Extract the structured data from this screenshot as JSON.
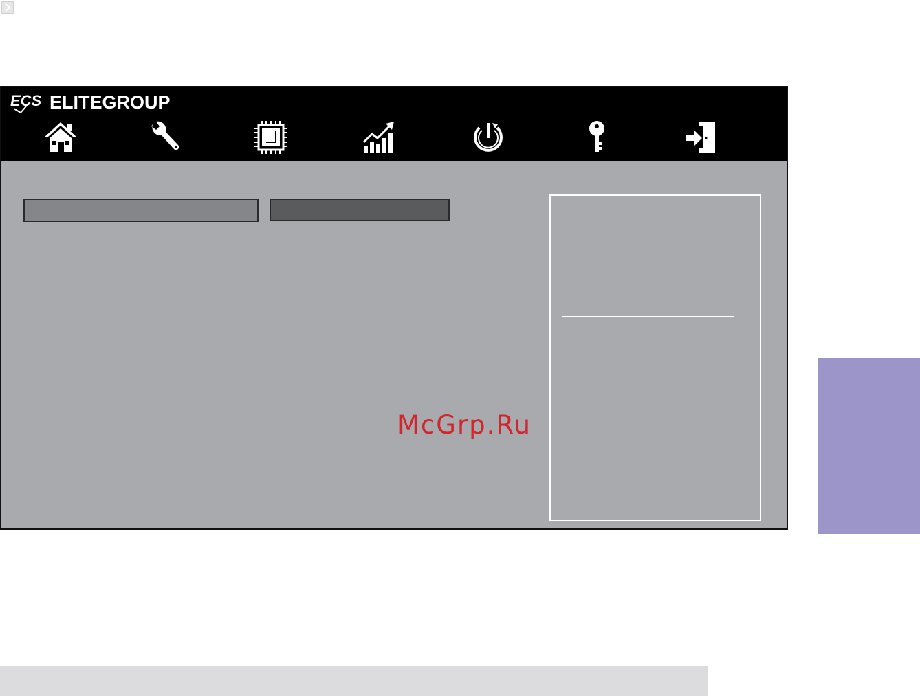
{
  "brand": {
    "logo_text": "ECS",
    "name": "ELITEGROUP"
  },
  "nav": {
    "items": [
      {
        "id": "main",
        "icon": "home-icon"
      },
      {
        "id": "advanced",
        "icon": "wrench-icon"
      },
      {
        "id": "chipset",
        "icon": "chip-icon"
      },
      {
        "id": "mib",
        "icon": "chart-up-icon"
      },
      {
        "id": "boot",
        "icon": "power-icon"
      },
      {
        "id": "security",
        "icon": "key-icon"
      },
      {
        "id": "exit",
        "icon": "exit-icon"
      }
    ]
  },
  "tabs": [
    {
      "label": ""
    },
    {
      "label": ""
    }
  ],
  "help_panel": {
    "top_text": "",
    "bottom_text": ""
  },
  "watermark": "McGrp.Ru",
  "colors": {
    "topbar": "#000000",
    "background": "#a9aaad",
    "tab_light": "#858689",
    "tab_dark": "#5a5b5d",
    "side_tab": "#9c95c9",
    "watermark": "#d0262e"
  }
}
